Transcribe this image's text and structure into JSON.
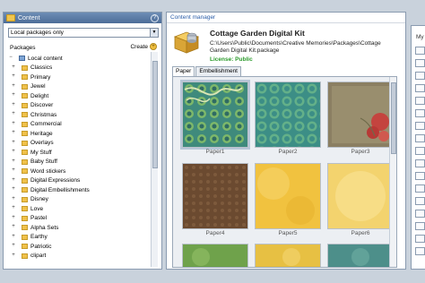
{
  "content_panel": {
    "title": "Content",
    "help_label": "?",
    "filter_value": "Local packages only",
    "packages_label": "Packages",
    "create_label": "Create",
    "tree_root": "Local content",
    "tree_items": [
      "Classics",
      "Primary",
      "Jewel",
      "Delight",
      "Discover",
      "Christmas",
      "Commercial",
      "Heritage",
      "Overlays",
      "My Stuff",
      "Baby Stuff",
      "Word stickers",
      "Digital Expressions",
      "Digital Embellishments",
      "Disney",
      "Love",
      "Pastel",
      "Alpha Sets",
      "Earthy",
      "Patriotic",
      "clipart"
    ]
  },
  "content_manager": {
    "title": "Content manager",
    "kit_title": "Cottage Garden Digital Kit",
    "kit_path": "C:\\Users\\Public\\Documents\\Creative Memories\\Packages\\Cottage Garden Digital Kit.package",
    "license": "License: Public",
    "tabs": [
      "Paper",
      "Embellishment"
    ],
    "papers": [
      "Paper1",
      "Paper2",
      "Paper3",
      "Paper4",
      "Paper5",
      "Paper6"
    ]
  },
  "right_panel": {
    "label": "My"
  },
  "colors": {
    "header_blue": "#4d6d98",
    "license_green": "#2a9a2a",
    "link_blue": "#2c5ea8"
  },
  "icons": [
    "folder-icon",
    "help-icon",
    "create-plus-icon",
    "package-box-icon",
    "tree-folder-icon"
  ]
}
